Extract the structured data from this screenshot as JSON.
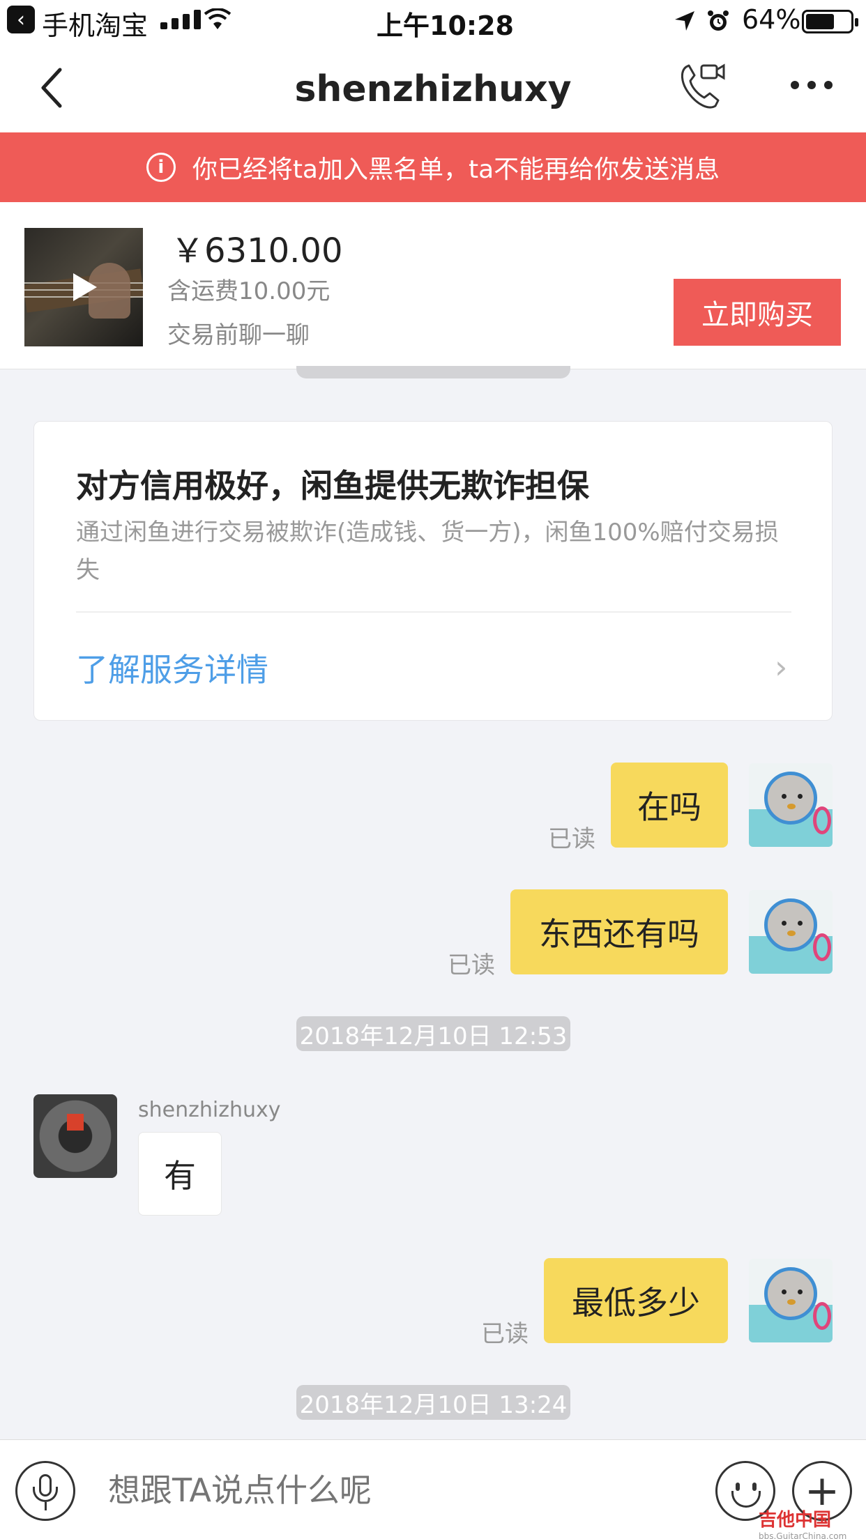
{
  "status_bar": {
    "app_name": "手机淘宝",
    "time": "上午10:28",
    "battery": "64%",
    "battery_level": 0.64
  },
  "nav": {
    "back_icon": "chevron-left-icon",
    "title": "shenzhizhuxy",
    "call_icon": "phone-video-icon",
    "more_icon": "more-dots-icon"
  },
  "alert": {
    "icon": "info-icon",
    "text": "你已经将ta加入黑名单，ta不能再给你发送消息",
    "color": "#ef5b57"
  },
  "product": {
    "price": "￥6310.00",
    "shipping": "含运费10.00元",
    "note": "交易前聊一聊",
    "buy_label": "立即购买",
    "play_icon": "play-icon"
  },
  "guarantee": {
    "title": "对方信用极好，闲鱼提供无欺诈担保",
    "description": "通过闲鱼进行交易被欺诈(造成钱、货一方)，闲鱼100%赔付交易损失",
    "link": "了解服务详情",
    "chevron": "›"
  },
  "messages": {
    "m1": {
      "text": "在吗",
      "status": "已读"
    },
    "m2": {
      "text": "东西还有吗",
      "status": "已读"
    },
    "time1": "2018年12月10日 12:53",
    "sender": "shenzhizhuxy",
    "m3": {
      "text": "有"
    },
    "m4": {
      "text": "最低多少",
      "status": "已读"
    },
    "time2": "2018年12月10日 13:24"
  },
  "input": {
    "placeholder": "想跟TA说点什么呢",
    "mic_icon": "microphone-icon",
    "emoji_icon": "emoji-icon",
    "plus_icon": "plus-icon",
    "plus_glyph": "+"
  },
  "watermark": {
    "text": "吉他中国",
    "sub": "bbs.GuitarChina.com"
  },
  "colors": {
    "my_bubble": "#f7d95c",
    "accent_red": "#ef5b57",
    "link_blue": "#4e9ee7"
  }
}
